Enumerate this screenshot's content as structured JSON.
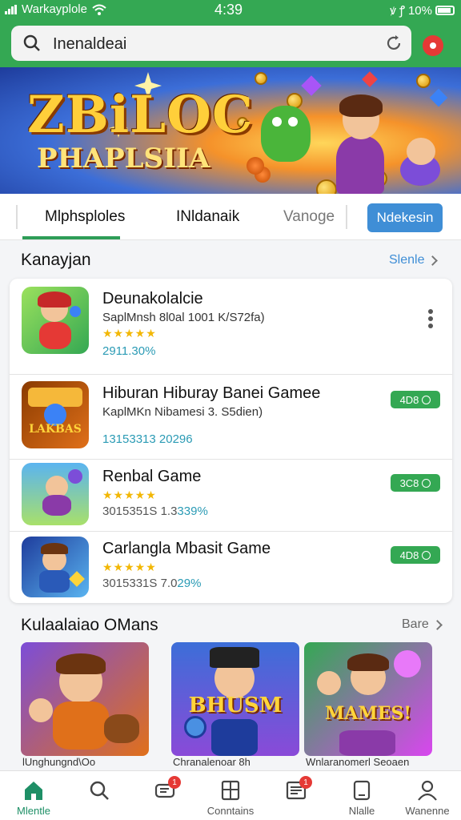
{
  "status_bar": {
    "carrier": "Warkayplole",
    "time": "4:39",
    "battery": "10%"
  },
  "search": {
    "value": "Inenaldeai"
  },
  "banner": {
    "title_line1": "ZBiLOC",
    "title_line2": "PHAPLSIIA"
  },
  "tabs": {
    "items": [
      {
        "label": "Mlphsploles"
      },
      {
        "label": "INldanaik"
      },
      {
        "label": "Vanoge"
      }
    ],
    "button_label": "Ndekesin"
  },
  "section1": {
    "title": "Kanayjan",
    "see_more": "Slenle"
  },
  "games": [
    {
      "title": "Deunakolalcie",
      "subtitle": "SaplMnsh 8l0al 1001 K/S72fa)",
      "rating": "★★★★★",
      "meta": "2911.30%",
      "meta_dark": ""
    },
    {
      "title": "Hiburan Hiburay Banei Gamee",
      "subtitle": "KaplMKn Nibamesi 3. S5dien)",
      "rating": "",
      "meta": "13153313 20296",
      "meta_dark": "",
      "download": "4D8"
    },
    {
      "title": "Renbal Game",
      "subtitle": "",
      "rating": "★★★★★",
      "meta": "3015351S 1.3",
      "meta_dark": "339%",
      "download": "3C8"
    },
    {
      "title": "Carlangla Mbasit Game",
      "subtitle": "",
      "rating": "★★★★★",
      "meta": "3015331S 7.0",
      "meta_dark": "29%",
      "download": "4D8"
    }
  ],
  "section2": {
    "title": "Kulaalaiao OMans",
    "see_more": "Bare"
  },
  "featured": [
    {
      "art_text": "",
      "caption": "lUnghungnd\\Oo"
    },
    {
      "art_text": "BHUSM",
      "caption": "Chranalenoar 8h"
    },
    {
      "art_text": "MAMES!",
      "caption": "Wnlaranomerl Seoaen"
    }
  ],
  "nav": [
    {
      "label": "Mlentle",
      "icon": "home-icon"
    },
    {
      "label": "",
      "icon": "search-icon"
    },
    {
      "label": "",
      "icon": "ticket-icon",
      "badge": "1"
    },
    {
      "label": "Conntains",
      "icon": "grid-icon"
    },
    {
      "label": "",
      "icon": "news-icon",
      "badge": "1"
    },
    {
      "label": "Nlalle",
      "icon": "tablet-icon"
    },
    {
      "label": "Wanenne",
      "icon": "profile-icon"
    }
  ],
  "colors": {
    "brand_green": "#34a853",
    "link_blue": "#3f8ed6",
    "badge_red": "#e53935",
    "star_gold": "#f2b705"
  }
}
